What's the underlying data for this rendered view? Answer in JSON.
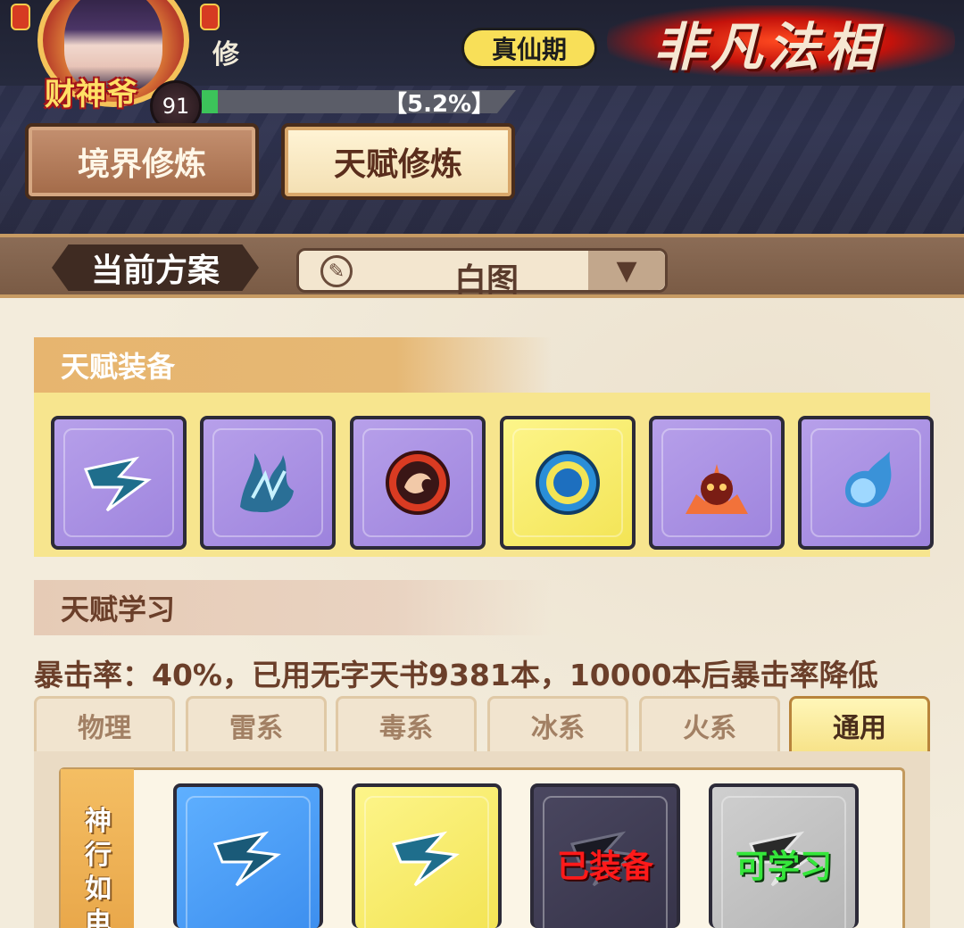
{
  "header": {
    "avatar_caption": "财神爷",
    "player_name": "修",
    "level": "91",
    "exp_text": "【5.2%】",
    "exp_progress": 0.052,
    "realm": "真仙期",
    "title_art": "非凡法相"
  },
  "tabs": [
    {
      "label": "境界修炼",
      "active": false
    },
    {
      "label": "天赋修炼",
      "active": true
    }
  ],
  "plan": {
    "label": "当前方案",
    "value": "白图",
    "brush_icon": "brush-icon",
    "dropdown_icon": "chevron-down-icon"
  },
  "equip": {
    "title": "天赋装备",
    "slots": [
      {
        "icon": "lightning-claw-icon",
        "color": "purple"
      },
      {
        "icon": "blue-flame-script-icon",
        "color": "purple"
      },
      {
        "icon": "dragon-seal-icon",
        "color": "purple"
      },
      {
        "icon": "water-ring-icon",
        "color": "yellow"
      },
      {
        "icon": "fire-demon-icon",
        "color": "purple"
      },
      {
        "icon": "blue-fireball-icon",
        "color": "purple"
      }
    ]
  },
  "learn": {
    "title": "天赋学习",
    "crit_text": "暴击率：40%，已用无字天书9381本，10000本后暴击率降低",
    "subtabs": [
      "物理",
      "雷系",
      "毒系",
      "冰系",
      "火系",
      "通用"
    ],
    "active_subtab": "通用",
    "row_label": "神行如电",
    "skills": [
      {
        "color": "blue",
        "status": ""
      },
      {
        "color": "yellow",
        "status": ""
      },
      {
        "color": "dark",
        "status": "已装备"
      },
      {
        "color": "gray",
        "status": "可学习"
      }
    ]
  },
  "colors": {
    "header_bg": "#2f3350",
    "parchment": "#f3ecdc",
    "exp_green": "#3cc35a",
    "realm_yellow": "#f8df58",
    "equipped_red": "#ff1a1a",
    "learnable_green": "#35e63b"
  }
}
